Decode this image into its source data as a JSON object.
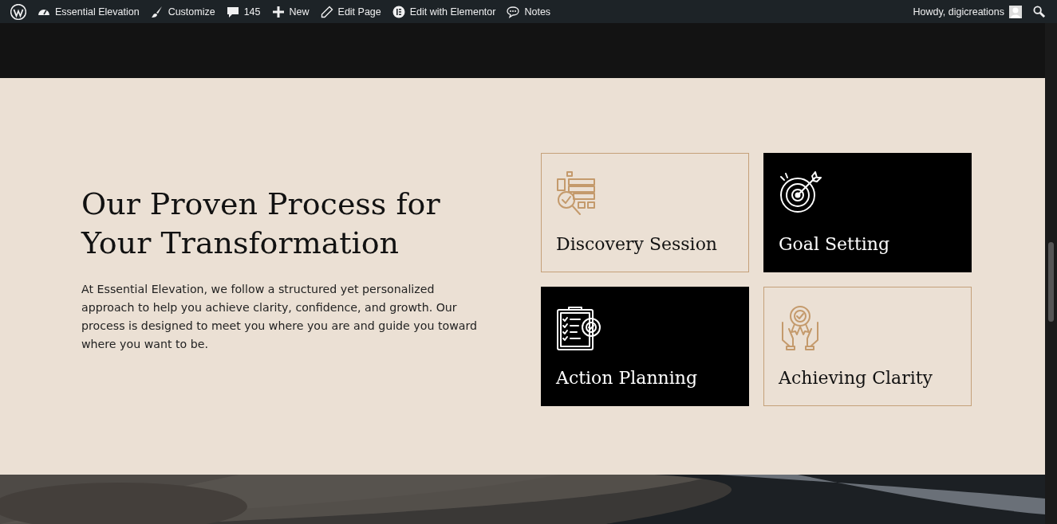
{
  "admin_bar": {
    "items": [
      {
        "kind": "logo"
      },
      {
        "kind": "dashboard",
        "label": "Essential Elevation"
      },
      {
        "kind": "brush",
        "label": "Customize"
      },
      {
        "kind": "comment",
        "label": "145"
      },
      {
        "kind": "plus",
        "label": "New"
      },
      {
        "kind": "pencil",
        "label": "Edit Page"
      },
      {
        "kind": "elementor",
        "label": "Edit with Elementor"
      },
      {
        "kind": "notes",
        "label": "Notes"
      }
    ],
    "greeting": "Howdy, digicreations"
  },
  "process": {
    "heading": "Our Proven Process for Your Transformation",
    "description": "At Essential Elevation, we follow a structured yet personalized approach to help you achieve clarity, confidence, and growth. Our process is designed to meet you where you are and guide you toward where you want to be.",
    "cards": [
      {
        "title": "Discovery Session",
        "kind": "light"
      },
      {
        "title": "Goal Setting",
        "kind": "dark"
      },
      {
        "title": "Action Planning",
        "kind": "dark"
      },
      {
        "title": "Achieving Clarity",
        "kind": "light"
      }
    ]
  }
}
